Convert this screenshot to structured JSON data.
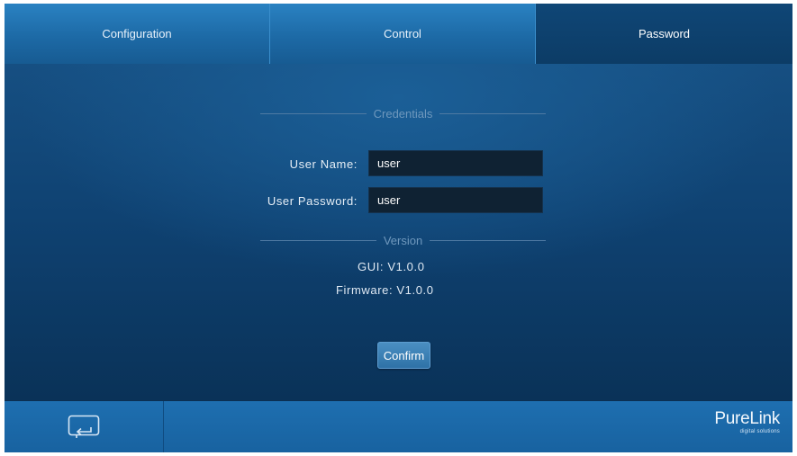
{
  "tabs": [
    {
      "label": "Configuration",
      "active": false
    },
    {
      "label": "Control",
      "active": false
    },
    {
      "label": "Password",
      "active": true
    }
  ],
  "credentials": {
    "title": "Credentials",
    "username_label": "User Name:",
    "username_value": "user",
    "password_label": "User Password:",
    "password_value": "user"
  },
  "version": {
    "title": "Version",
    "gui_label": "GUI:",
    "gui_value": "V1.0.0",
    "firmware_label": "Firmware:",
    "firmware_value": "V1.0.0"
  },
  "confirm_label": "Confirm",
  "footer": {
    "back_icon": "return-screen-icon",
    "brand_name": "PureLink",
    "brand_tagline": "digital solutions"
  },
  "colors": {
    "tab_active": "#0c3c66",
    "tab_inactive": "#1d6aa6",
    "main_bg": "#0f4272",
    "input_bg": "#0f2233",
    "footer_bg": "#1e6fb0",
    "button": "#3a7eb3"
  }
}
